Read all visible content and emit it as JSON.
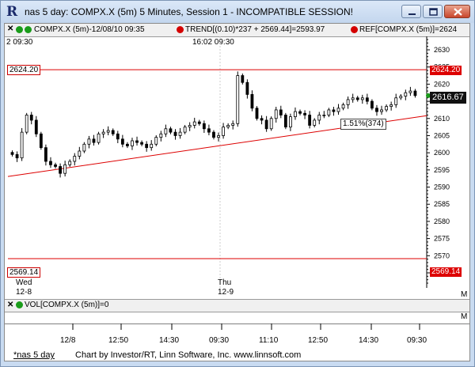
{
  "window": {
    "title": "nas 5 day: COMPX.X (5m) 5 Minutes, Session 1 - INCOMPATIBLE SESSION!",
    "app_icon": "R"
  },
  "chart_header": {
    "symbol": "COMPX.X (5m)-12/08/10 09:35",
    "trend": "TREND[(0.10)*237 + 2569.44]=2593.97",
    "ref": "REF[COMPX.X (5m)]=2624"
  },
  "chart_time_labels": {
    "left": "2  09:30",
    "middle": "16:02  09:30"
  },
  "levels": {
    "upper": "2624.20",
    "lower": "2569.14",
    "last_price": "2616.67",
    "pct_change": "1.51%(374)"
  },
  "day_labels": [
    {
      "dow": "Wed",
      "date": "12-8"
    },
    {
      "dow": "Thu",
      "date": "12-9"
    }
  ],
  "volume_header": "VOL[COMPX.X (5m)]=0",
  "panel_markers": {
    "chart": "M",
    "volume": "M"
  },
  "x_axis_labels": [
    "12/8",
    "12:50",
    "14:30",
    "09:30",
    "11:10",
    "12:50",
    "14:30",
    "09:30"
  ],
  "footer": {
    "tab": "*nas 5 day",
    "credit": "Chart by Investor/RT, Linn Software, Inc. www.linnsoft.com"
  },
  "colors": {
    "up": "#000000",
    "down": "#000000",
    "trend": "#dd0000",
    "ref": "#dd0000"
  },
  "chart_data": {
    "type": "candlestick",
    "title": "COMPX.X (5m)",
    "y_ticks": [
      2630,
      2625,
      2620,
      2615,
      2610,
      2605,
      2600,
      2595,
      2590,
      2585,
      2580,
      2575,
      2570,
      2565
    ],
    "ylim": [
      2562,
      2633
    ],
    "x_ticks": [
      "12/8",
      "12:50",
      "14:30",
      "09:30",
      "11:10",
      "12:50",
      "14:30",
      "09:30"
    ],
    "series": [
      {
        "name": "TREND",
        "start": 2593.1,
        "end": 2610.8
      },
      {
        "name": "REF upper",
        "value": 2624.2
      },
      {
        "name": "REF lower",
        "value": 2569.14
      }
    ],
    "closes": [
      2599.5,
      2598.5,
      2606.0,
      2611.0,
      2609.5,
      2605.5,
      2601.5,
      2597.5,
      2596.5,
      2596.0,
      2594.0,
      2596.5,
      2597.5,
      2599.0,
      2600.5,
      2602.5,
      2604.0,
      2603.0,
      2605.5,
      2606.0,
      2606.5,
      2605.5,
      2604.0,
      2602.5,
      2602.0,
      2603.5,
      2603.0,
      2602.5,
      2601.5,
      2602.5,
      2604.5,
      2605.5,
      2607.0,
      2606.0,
      2605.0,
      2606.0,
      2607.5,
      2608.0,
      2609.0,
      2608.5,
      2607.0,
      2606.0,
      2604.5,
      2605.0,
      2607.5,
      2608.0,
      2608.5,
      2622.5,
      2620.5,
      2617.0,
      2613.0,
      2610.0,
      2609.5,
      2607.0,
      2610.0,
      2612.5,
      2611.0,
      2607.5,
      2610.5,
      2612.0,
      2611.5,
      2611.0,
      2608.0,
      2609.5,
      2611.0,
      2611.0,
      2612.5,
      2612.0,
      2613.0,
      2614.0,
      2615.5,
      2616.0,
      2615.5,
      2616.0,
      2615.0,
      2613.0,
      2612.0,
      2612.5,
      2613.5,
      2614.0,
      2616.0,
      2616.5,
      2617.5,
      2618.0,
      2616.67
    ]
  }
}
